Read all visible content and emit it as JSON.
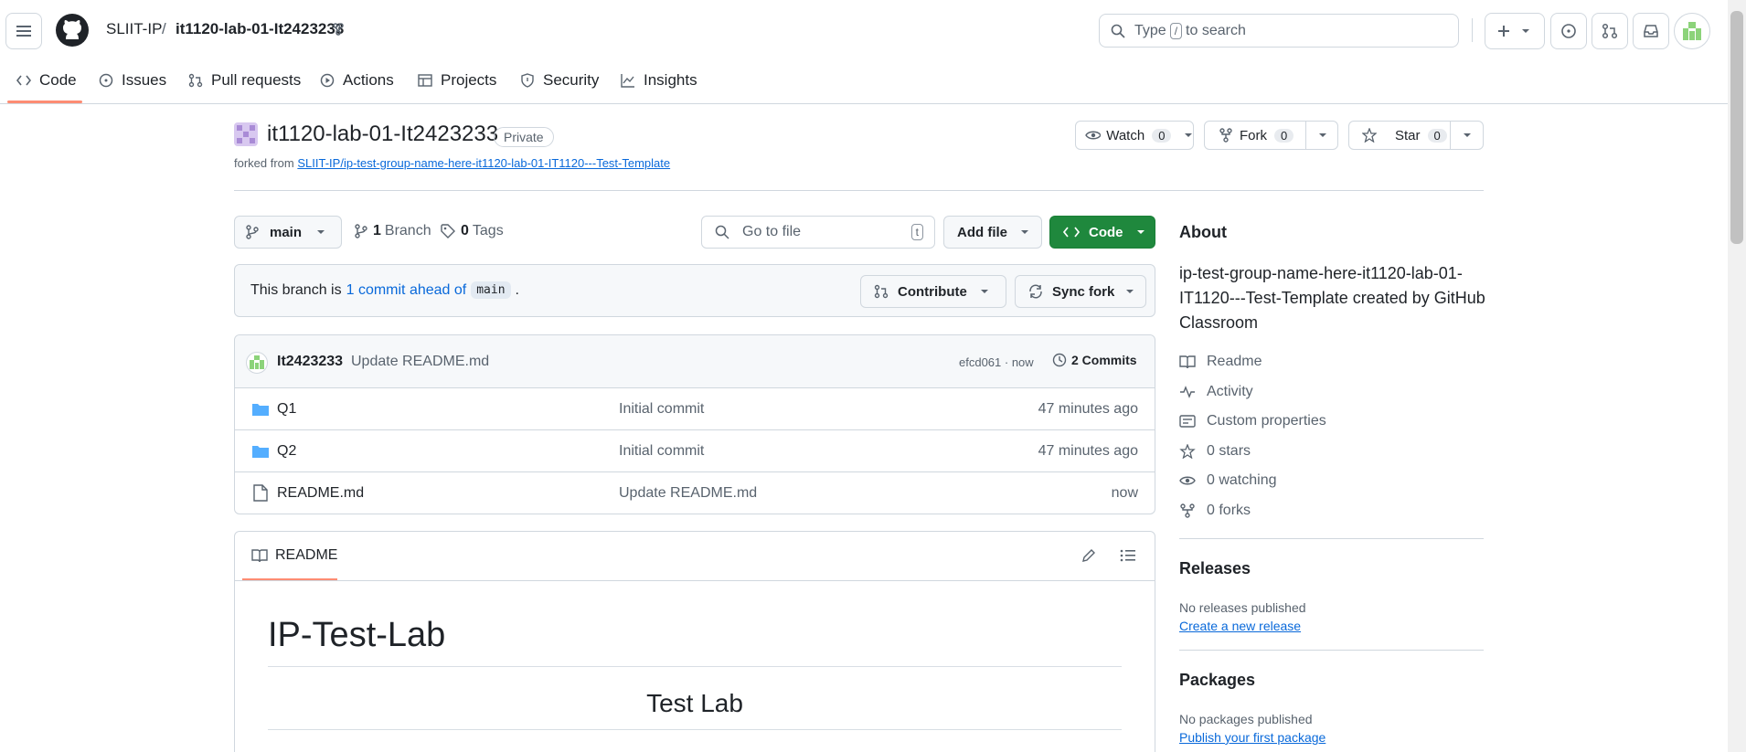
{
  "header": {
    "org": "SLIIT-IP",
    "separator": "/",
    "repo": "it1120-lab-01-It2423233",
    "search_prefix": "Type",
    "search_key": "/",
    "search_suffix": "to search"
  },
  "nav": {
    "tabs": [
      "Code",
      "Issues",
      "Pull requests",
      "Actions",
      "Projects",
      "Security",
      "Insights"
    ]
  },
  "repo": {
    "title": "it1120-lab-01-It2423233",
    "visibility": "Private",
    "forked_prefix": "forked from",
    "forked_link": "SLIIT-IP/ip-test-group-name-here-it1120-lab-01-IT1120---Test-Template",
    "watch_label": "Watch",
    "watch_count": "0",
    "fork_label": "Fork",
    "fork_count": "0",
    "star_label": "Star",
    "star_count": "0"
  },
  "toolbar": {
    "branch": "main",
    "branches_count": "1",
    "branches_label": "Branch",
    "tags_count": "0",
    "tags_label": "Tags",
    "go_to_file": "Go to file",
    "go_to_file_key": "t",
    "add_file": "Add file",
    "code": "Code"
  },
  "ahead": {
    "prefix": "This branch is",
    "link": "1 commit ahead of",
    "branch": "main",
    "suffix": ".",
    "contribute": "Contribute",
    "sync": "Sync fork"
  },
  "commit": {
    "author": "It2423233",
    "message": "Update README.md",
    "hash_time": "efcd061 · now",
    "commits_label": "2 Commits"
  },
  "files": [
    {
      "name": "Q1",
      "type": "folder",
      "message": "Initial commit",
      "time": "47 minutes ago"
    },
    {
      "name": "Q2",
      "type": "folder",
      "message": "Initial commit",
      "time": "47 minutes ago"
    },
    {
      "name": "README.md",
      "type": "file",
      "message": "Update README.md",
      "time": "now"
    }
  ],
  "readme": {
    "tab": "README",
    "h1": "IP-Test-Lab",
    "h2": "Test Lab"
  },
  "about": {
    "heading": "About",
    "description": "ip-test-group-name-here-it1120-lab-01-IT1120---Test-Template created by GitHub Classroom",
    "readme": "Readme",
    "activity": "Activity",
    "custom_properties": "Custom properties",
    "stars": "0 stars",
    "watching": "0 watching",
    "forks": "0 forks"
  },
  "releases": {
    "heading": "Releases",
    "none": "No releases published",
    "create": "Create a new release"
  },
  "packages": {
    "heading": "Packages",
    "none": "No packages published",
    "publish": "Publish your first package"
  },
  "colors": {
    "code_button": "#1f883d",
    "link": "#0969da",
    "tab_underline": "#fd8c73",
    "folder": "#54aeff"
  }
}
